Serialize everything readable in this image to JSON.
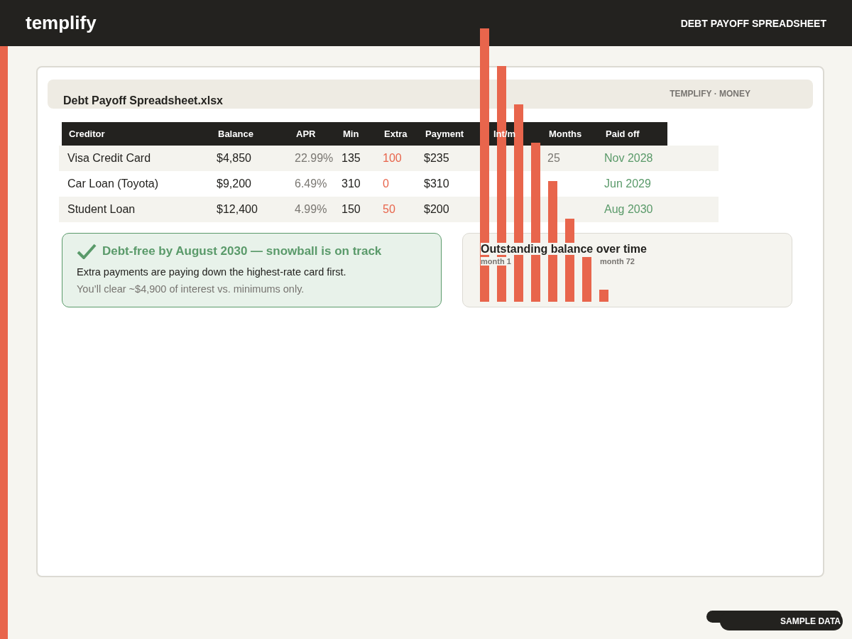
{
  "topbar": {
    "logo": "templify",
    "title": "DEBT PAYOFF SPREADSHEET"
  },
  "sheet": {
    "filename": "Debt Payoff Spreadsheet.xlsx",
    "tag": "TEMPLIFY · MONEY"
  },
  "table": {
    "columns": [
      "Creditor",
      "Balance",
      "APR",
      "Min",
      "Extra",
      "Payment",
      "Int/m",
      "Months",
      "Paid off"
    ],
    "rows": [
      {
        "creditor": "Visa Credit Card",
        "balance": "$4,850",
        "apr": "22.99%",
        "min": "135",
        "extra": "100",
        "payment": "$235",
        "months": "25",
        "paid_off": "Nov 2028"
      },
      {
        "creditor": "Car Loan (Toyota)",
        "balance": "$9,200",
        "apr": "6.49%",
        "min": "310",
        "extra": "0",
        "payment": "$310",
        "paid_off": "Jun 2029"
      },
      {
        "creditor": "Student Loan",
        "balance": "$12,400",
        "apr": "4.99%",
        "min": "150",
        "extra": "50",
        "payment": "$200",
        "paid_off": "Aug 2030"
      }
    ]
  },
  "alert": {
    "title": "Debt-free by August 2030 — snowball is on track",
    "text": "Extra payments are paying down the highest-rate card first.",
    "note": "You’ll clear ~$4,900 of interest vs. minimums only."
  },
  "chart": {
    "title": "Outstanding balance over time",
    "start_label": "month 1",
    "end_label": "month 72"
  },
  "badge": "SAMPLE DATA"
}
